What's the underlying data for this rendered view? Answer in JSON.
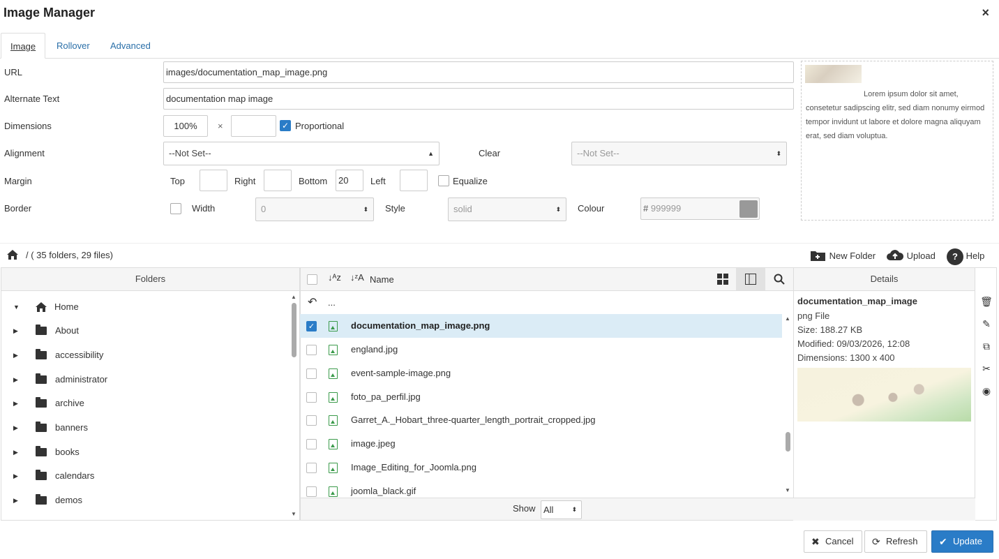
{
  "dialog": {
    "title": "Image Manager",
    "close": "×"
  },
  "tabs": [
    "Image",
    "Rollover",
    "Advanced"
  ],
  "form": {
    "url_label": "URL",
    "url_value": "images/documentation_map_image.png",
    "alt_label": "Alternate Text",
    "alt_value": "documentation map image",
    "dim_label": "Dimensions",
    "width_value": "100%",
    "times": "×",
    "height_value": "",
    "proportional_label": "Proportional",
    "align_label": "Alignment",
    "align_value": "--Not Set--",
    "clear_label": "Clear",
    "clear_value": "--Not Set--",
    "margin_label": "Margin",
    "top_label": "Top",
    "right_label": "Right",
    "bottom_label": "Bottom",
    "bottom_value": "20",
    "left_label": "Left",
    "equalize_label": "Equalize",
    "border_label": "Border",
    "width_label": "Width",
    "border_width_value": "0",
    "style_label": "Style",
    "style_value": "solid",
    "colour_label": "Colour",
    "colour_hash": "#",
    "colour_value": "999999",
    "swatch_color": "#999999"
  },
  "preview": {
    "text": "Lorem ipsum dolor sit amet, consetetur sadipscing elitr, sed diam nonumy eirmod tempor invidunt ut labore et dolore magna aliquyam erat, sed diam voluptua."
  },
  "browser": {
    "path": "/ ( 35 folders, 29 files)",
    "new_folder": "New Folder",
    "upload": "Upload",
    "help": "Help",
    "folders_header": "Folders",
    "name_header": "Name",
    "details_header": "Details",
    "folders": [
      "Home",
      "About",
      "accessibility",
      "administrator",
      "archive",
      "banners",
      "books",
      "calendars",
      "demos"
    ],
    "parent": "...",
    "files": [
      "documentation_map_image.png",
      "england.jpg",
      "event-sample-image.png",
      "foto_pa_perfil.jpg",
      "Garret_A._Hobart_three-quarter_length_portrait_cropped.jpg",
      "image.jpeg",
      "Image_Editing_for_Joomla.png",
      "joomla_black.gif"
    ],
    "show_label": "Show",
    "show_value": "All"
  },
  "details": {
    "name": "documentation_map_image",
    "type": "png File",
    "size": "Size: 188.27 KB",
    "modified": "Modified: 09/03/2026, 12:08",
    "dimensions": "Dimensions: 1300 x 400"
  },
  "buttons": {
    "cancel": "Cancel",
    "refresh": "Refresh",
    "update": "Update"
  }
}
